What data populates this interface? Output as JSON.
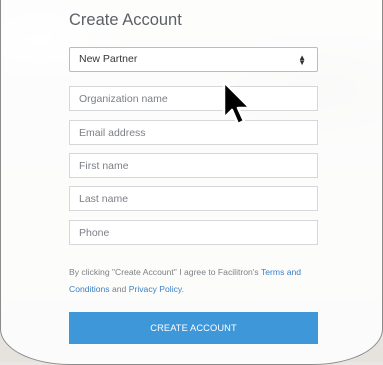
{
  "form": {
    "title": "Create Account",
    "partner_type": {
      "selected": "New Partner"
    },
    "organization_placeholder": "Organization name",
    "email_placeholder": "Email address",
    "first_name_placeholder": "First name",
    "last_name_placeholder": "Last name",
    "phone_placeholder": "Phone",
    "legal": {
      "prefix": "By clicking \"Create Account\" I agree to Facilitron's ",
      "terms_link": "Terms and Conditions",
      "middle": " and ",
      "privacy_link": "Privacy Policy",
      "suffix": "."
    },
    "submit_label": "CREATE ACCOUNT"
  },
  "colors": {
    "accent": "#3d97d8",
    "link": "#3d7fc7"
  }
}
